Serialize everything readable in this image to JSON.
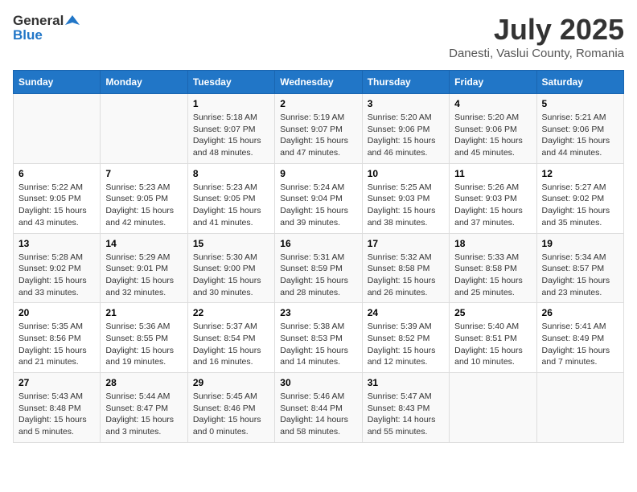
{
  "header": {
    "logo_general": "General",
    "logo_blue": "Blue",
    "month_title": "July 2025",
    "subtitle": "Danesti, Vaslui County, Romania"
  },
  "days_of_week": [
    "Sunday",
    "Monday",
    "Tuesday",
    "Wednesday",
    "Thursday",
    "Friday",
    "Saturday"
  ],
  "weeks": [
    [
      {
        "day": "",
        "info": ""
      },
      {
        "day": "",
        "info": ""
      },
      {
        "day": "1",
        "info": "Sunrise: 5:18 AM\nSunset: 9:07 PM\nDaylight: 15 hours and 48 minutes."
      },
      {
        "day": "2",
        "info": "Sunrise: 5:19 AM\nSunset: 9:07 PM\nDaylight: 15 hours and 47 minutes."
      },
      {
        "day": "3",
        "info": "Sunrise: 5:20 AM\nSunset: 9:06 PM\nDaylight: 15 hours and 46 minutes."
      },
      {
        "day": "4",
        "info": "Sunrise: 5:20 AM\nSunset: 9:06 PM\nDaylight: 15 hours and 45 minutes."
      },
      {
        "day": "5",
        "info": "Sunrise: 5:21 AM\nSunset: 9:06 PM\nDaylight: 15 hours and 44 minutes."
      }
    ],
    [
      {
        "day": "6",
        "info": "Sunrise: 5:22 AM\nSunset: 9:05 PM\nDaylight: 15 hours and 43 minutes."
      },
      {
        "day": "7",
        "info": "Sunrise: 5:23 AM\nSunset: 9:05 PM\nDaylight: 15 hours and 42 minutes."
      },
      {
        "day": "8",
        "info": "Sunrise: 5:23 AM\nSunset: 9:05 PM\nDaylight: 15 hours and 41 minutes."
      },
      {
        "day": "9",
        "info": "Sunrise: 5:24 AM\nSunset: 9:04 PM\nDaylight: 15 hours and 39 minutes."
      },
      {
        "day": "10",
        "info": "Sunrise: 5:25 AM\nSunset: 9:03 PM\nDaylight: 15 hours and 38 minutes."
      },
      {
        "day": "11",
        "info": "Sunrise: 5:26 AM\nSunset: 9:03 PM\nDaylight: 15 hours and 37 minutes."
      },
      {
        "day": "12",
        "info": "Sunrise: 5:27 AM\nSunset: 9:02 PM\nDaylight: 15 hours and 35 minutes."
      }
    ],
    [
      {
        "day": "13",
        "info": "Sunrise: 5:28 AM\nSunset: 9:02 PM\nDaylight: 15 hours and 33 minutes."
      },
      {
        "day": "14",
        "info": "Sunrise: 5:29 AM\nSunset: 9:01 PM\nDaylight: 15 hours and 32 minutes."
      },
      {
        "day": "15",
        "info": "Sunrise: 5:30 AM\nSunset: 9:00 PM\nDaylight: 15 hours and 30 minutes."
      },
      {
        "day": "16",
        "info": "Sunrise: 5:31 AM\nSunset: 8:59 PM\nDaylight: 15 hours and 28 minutes."
      },
      {
        "day": "17",
        "info": "Sunrise: 5:32 AM\nSunset: 8:58 PM\nDaylight: 15 hours and 26 minutes."
      },
      {
        "day": "18",
        "info": "Sunrise: 5:33 AM\nSunset: 8:58 PM\nDaylight: 15 hours and 25 minutes."
      },
      {
        "day": "19",
        "info": "Sunrise: 5:34 AM\nSunset: 8:57 PM\nDaylight: 15 hours and 23 minutes."
      }
    ],
    [
      {
        "day": "20",
        "info": "Sunrise: 5:35 AM\nSunset: 8:56 PM\nDaylight: 15 hours and 21 minutes."
      },
      {
        "day": "21",
        "info": "Sunrise: 5:36 AM\nSunset: 8:55 PM\nDaylight: 15 hours and 19 minutes."
      },
      {
        "day": "22",
        "info": "Sunrise: 5:37 AM\nSunset: 8:54 PM\nDaylight: 15 hours and 16 minutes."
      },
      {
        "day": "23",
        "info": "Sunrise: 5:38 AM\nSunset: 8:53 PM\nDaylight: 15 hours and 14 minutes."
      },
      {
        "day": "24",
        "info": "Sunrise: 5:39 AM\nSunset: 8:52 PM\nDaylight: 15 hours and 12 minutes."
      },
      {
        "day": "25",
        "info": "Sunrise: 5:40 AM\nSunset: 8:51 PM\nDaylight: 15 hours and 10 minutes."
      },
      {
        "day": "26",
        "info": "Sunrise: 5:41 AM\nSunset: 8:49 PM\nDaylight: 15 hours and 7 minutes."
      }
    ],
    [
      {
        "day": "27",
        "info": "Sunrise: 5:43 AM\nSunset: 8:48 PM\nDaylight: 15 hours and 5 minutes."
      },
      {
        "day": "28",
        "info": "Sunrise: 5:44 AM\nSunset: 8:47 PM\nDaylight: 15 hours and 3 minutes."
      },
      {
        "day": "29",
        "info": "Sunrise: 5:45 AM\nSunset: 8:46 PM\nDaylight: 15 hours and 0 minutes."
      },
      {
        "day": "30",
        "info": "Sunrise: 5:46 AM\nSunset: 8:44 PM\nDaylight: 14 hours and 58 minutes."
      },
      {
        "day": "31",
        "info": "Sunrise: 5:47 AM\nSunset: 8:43 PM\nDaylight: 14 hours and 55 minutes."
      },
      {
        "day": "",
        "info": ""
      },
      {
        "day": "",
        "info": ""
      }
    ]
  ]
}
